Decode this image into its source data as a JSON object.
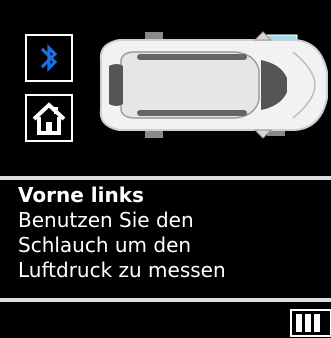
{
  "status_bar": {
    "bluetooth_icon": "bluetooth-icon",
    "home_icon": "home-icon",
    "battery_icon": "battery-icon"
  },
  "vehicle": {
    "view": "top-down SUV",
    "highlighted_position": "front-left",
    "highlight_color": "#9fe0ea"
  },
  "message": {
    "title": "Vorne links",
    "lines": [
      "Benutzen Sie den",
      "Schlauch um den",
      "Luftdruck zu messen"
    ]
  },
  "colors": {
    "background": "#000000",
    "text": "#ffffff",
    "bluetooth": "#1f6fe0",
    "tire": "#8a8a8a"
  }
}
